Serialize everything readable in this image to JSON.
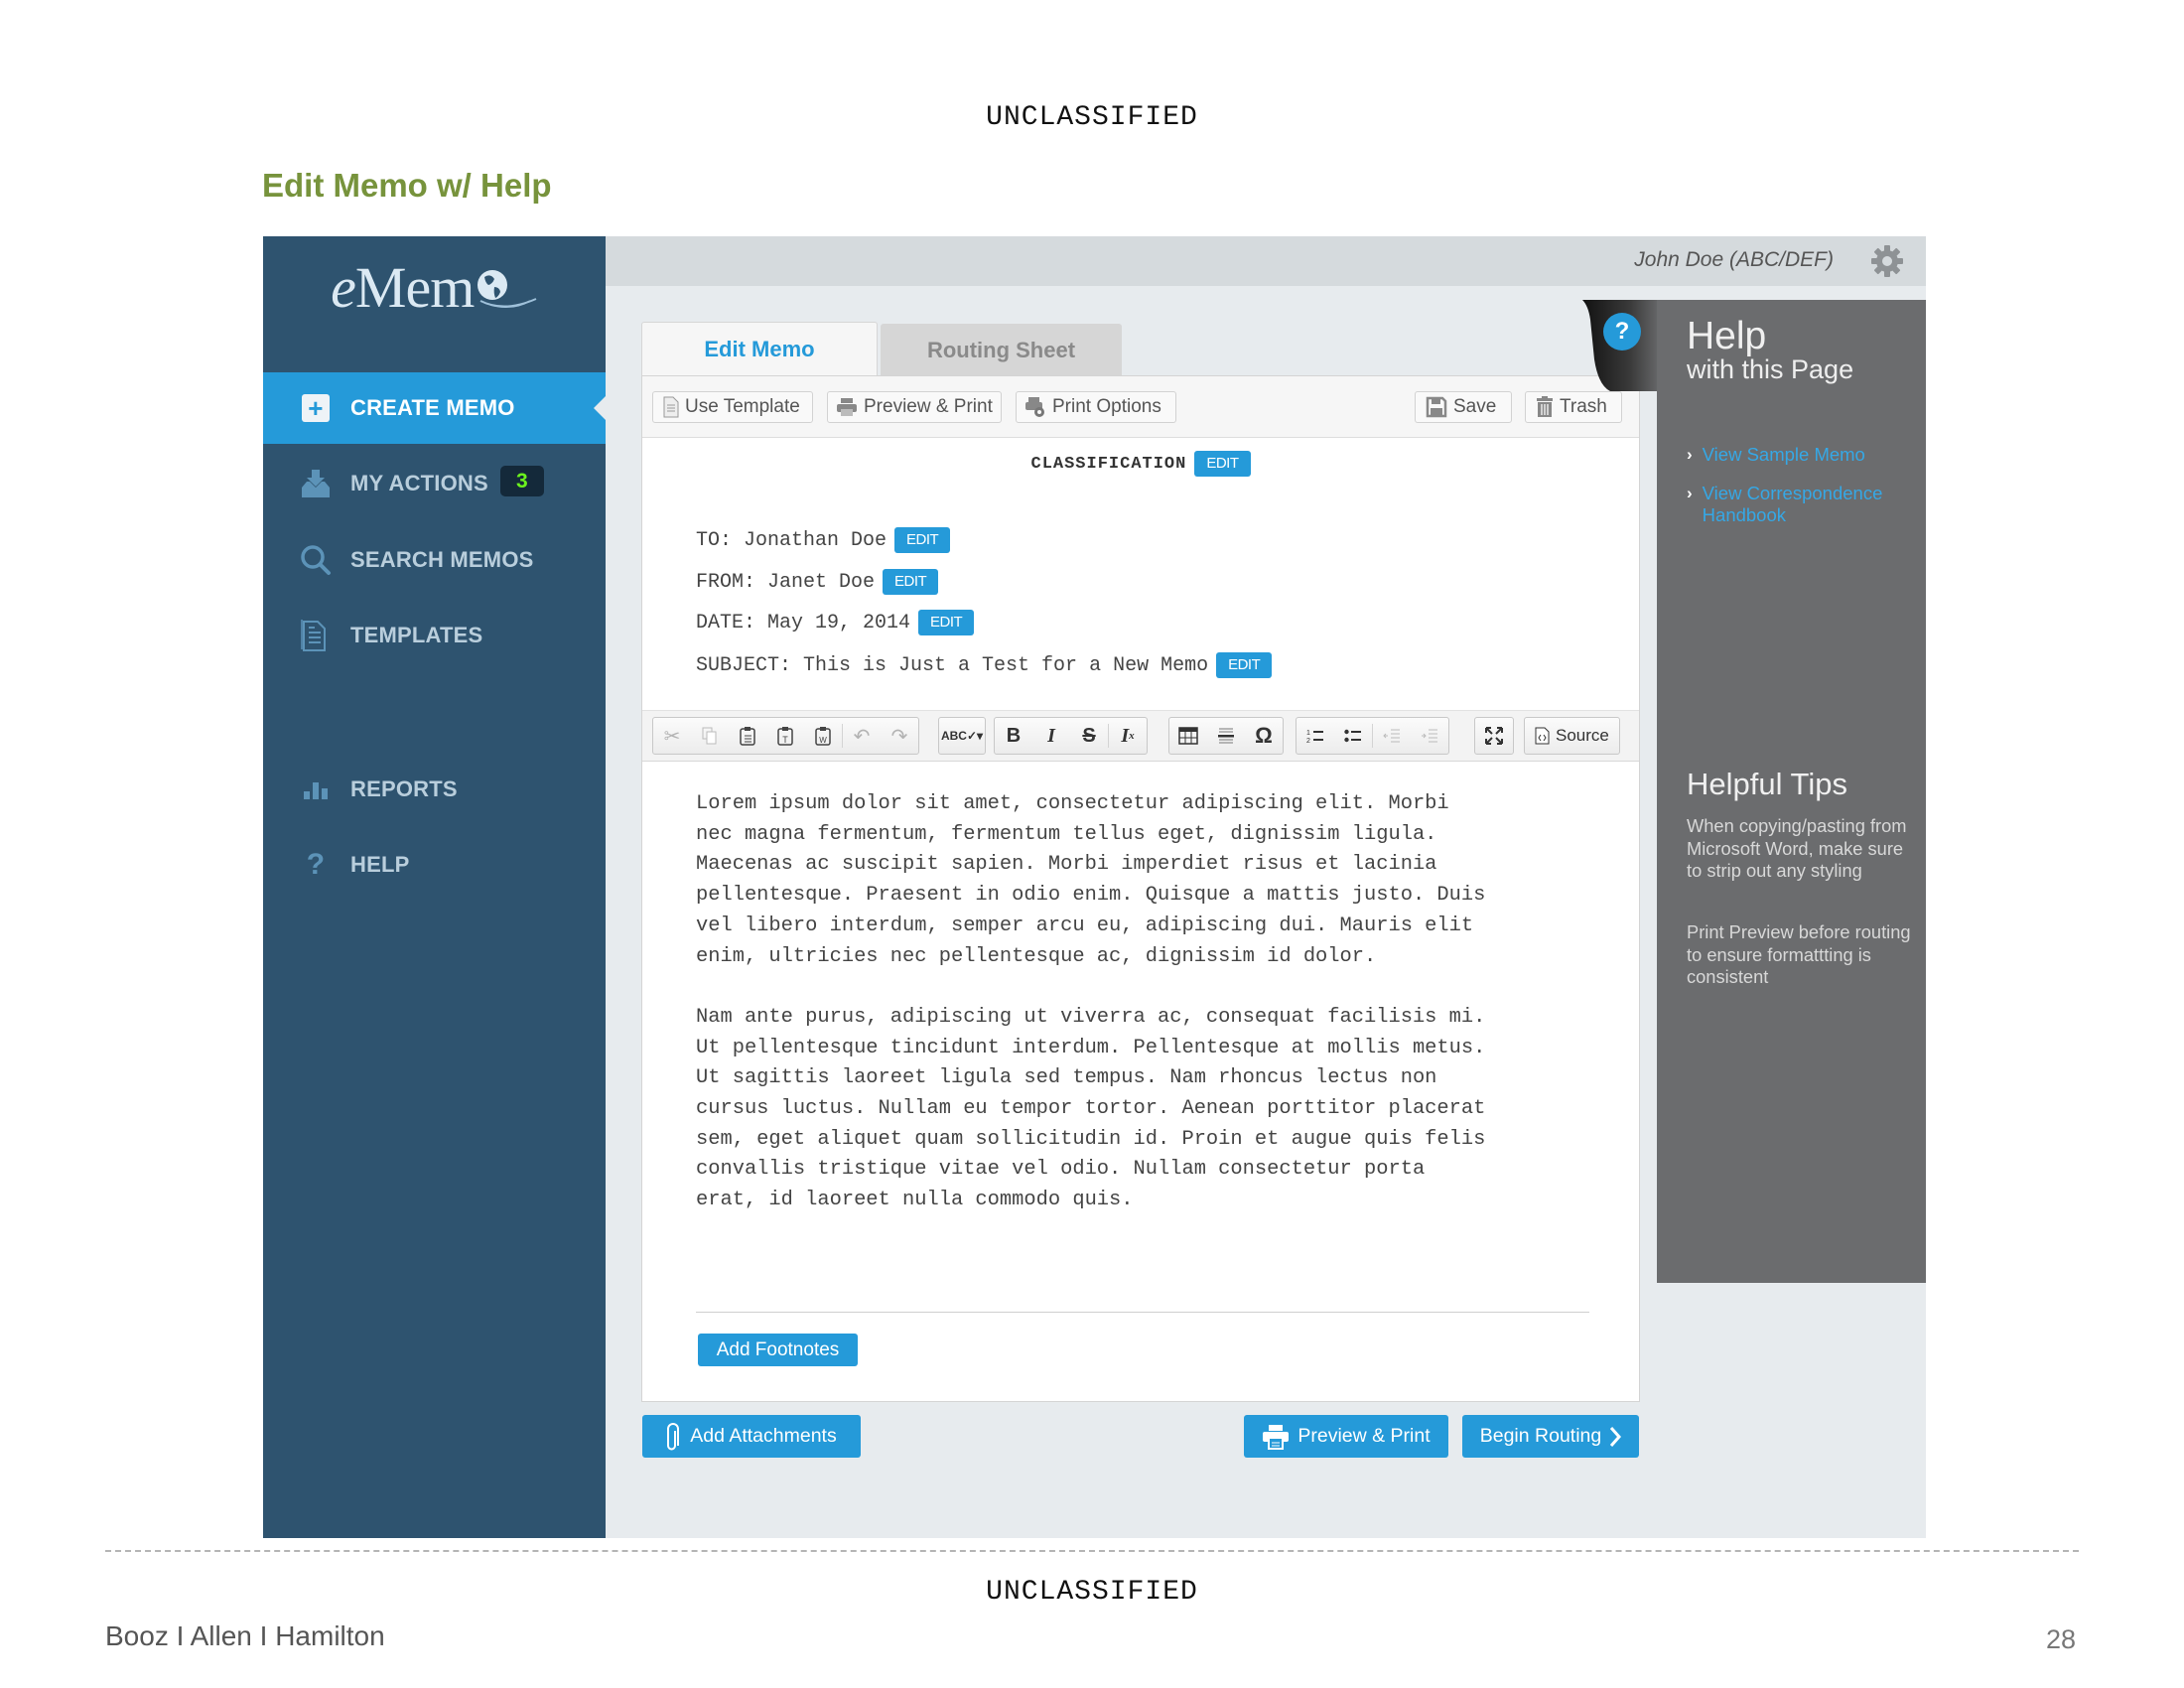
{
  "page": {
    "classification_top": "UNCLASSIFIED",
    "classification_bottom": "UNCLASSIFIED",
    "slide_title": "Edit Memo w/ Help",
    "footer_brand": "Booz I Allen I Hamilton",
    "page_number": "28"
  },
  "app": {
    "logo": {
      "prefix": "e",
      "text": "Mem"
    },
    "user": "John Doe (ABC/DEF)",
    "sidebar": {
      "items": [
        {
          "label": "CREATE MEMO",
          "icon": "plus-square-icon",
          "active": true
        },
        {
          "label": "MY ACTIONS",
          "icon": "inbox-download-icon",
          "badge": "3"
        },
        {
          "label": "SEARCH MEMOS",
          "icon": "search-icon"
        },
        {
          "label": "TEMPLATES",
          "icon": "document-icon"
        },
        {
          "label": "REPORTS",
          "icon": "bar-chart-icon"
        },
        {
          "label": "HELP",
          "icon": "question-icon"
        }
      ]
    },
    "tabs": [
      {
        "label": "Edit Memo",
        "active": true
      },
      {
        "label": "Routing Sheet",
        "active": false
      }
    ],
    "toolbar": {
      "use_template": "Use Template",
      "preview_print": "Preview & Print",
      "print_options": "Print Options",
      "save": "Save",
      "trash": "Trash"
    },
    "memo": {
      "classification_label": "CLASSIFICATION",
      "edit_label": "EDIT",
      "to": "TO: Jonathan Doe",
      "from": "FROM: Janet Doe",
      "date": "DATE: May 19, 2014",
      "subject": "SUBJECT: This is Just a Test for a New Memo",
      "body_lines": [
        "Lorem ipsum dolor sit amet, consectetur adipiscing elit. Morbi",
        "nec magna fermentum, fermentum tellus eget, dignissim ligula.",
        "Maecenas ac suscipit sapien. Morbi imperdiet risus et lacinia",
        "pellentesque. Praesent in odio enim. Quisque a mattis justo. Duis",
        "vel libero interdum, semper arcu eu, adipiscing dui. Mauris elit",
        "enim, ultricies nec pellentesque ac, dignissim id dolor.",
        "",
        "Nam ante purus, adipiscing ut viverra ac, consequat facilisis mi.",
        "Ut pellentesque tincidunt interdum. Pellentesque at mollis metus.",
        "Ut sagittis laoreet ligula sed tempus. Nam rhoncus lectus non",
        "cursus luctus. Nullam eu tempor tortor. Aenean porttitor placerat",
        "sem, eget aliquet quam sollicitudin id. Proin et augue quis felis",
        "convallis tristique vitae vel odio. Nullam consectetur porta",
        "erat, id laoreet nulla commodo quis."
      ],
      "add_footnotes": "Add Footnotes"
    },
    "editor_toolbar": {
      "source_label": "Source"
    },
    "bottom_actions": {
      "add_attachments": "Add Attachments",
      "preview_print": "Preview & Print",
      "begin_routing": "Begin Routing"
    },
    "help": {
      "title": "Help",
      "subtitle": "with this Page",
      "links": [
        "View Sample Memo",
        "View Correspondence",
        "Handbook"
      ],
      "tips_title": "Helpful Tips",
      "tips": [
        "When copying/pasting from Microsoft Word, make sure to strip out any styling",
        "Print Preview before routing to ensure formattting is consistent"
      ]
    },
    "colors": {
      "sidebar": "#2e536f",
      "accent": "#259ad9",
      "help_panel": "#6b6c6e",
      "title_green": "#77933c",
      "badge_text": "#6bf21e"
    }
  }
}
